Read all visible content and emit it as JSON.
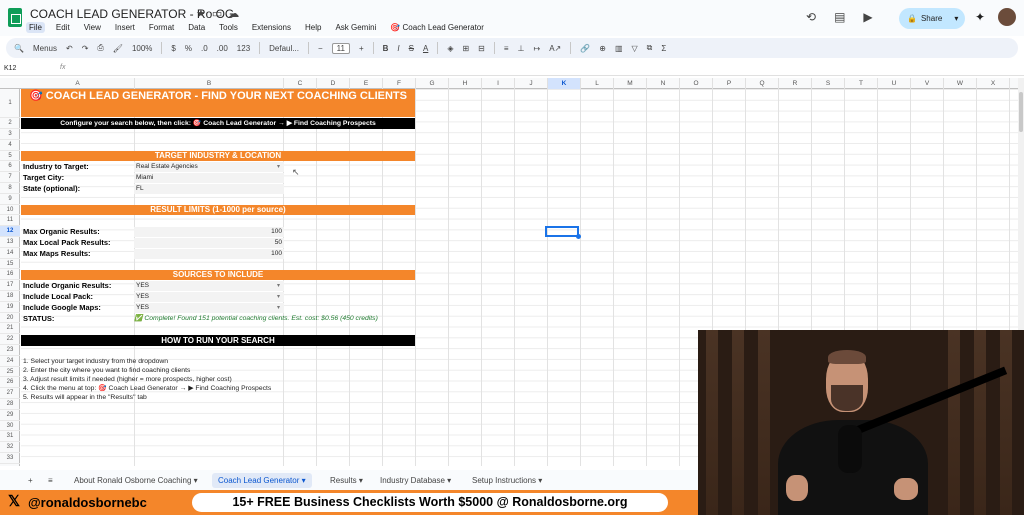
{
  "titlebar": {
    "doc_title": "COACH LEAD GENERATOR - Ro OG",
    "menu": [
      "File",
      "Edit",
      "View",
      "Insert",
      "Format",
      "Data",
      "Tools",
      "Extensions",
      "Help",
      "Ask Gemini"
    ],
    "custom_menu": "🎯 Coach Lead Generator",
    "share_label": "Share"
  },
  "toolbar": {
    "menus_label": "Menus",
    "zoom": "100%",
    "currency": "$",
    "percent": "%",
    "dec1": ".0",
    "dec2": ".00",
    "num_fmt": "123",
    "font": "Defaul...",
    "font_size": "11"
  },
  "formula": {
    "cell_ref": "K12",
    "fx": "fx"
  },
  "columns": [
    "A",
    "B",
    "C",
    "D",
    "E",
    "F",
    "G",
    "H",
    "I",
    "J",
    "K",
    "L",
    "M",
    "N",
    "O",
    "P",
    "Q",
    "R",
    "S",
    "T",
    "U",
    "V",
    "W",
    "X"
  ],
  "rows": [
    "1",
    "2",
    "3",
    "4",
    "5",
    "6",
    "7",
    "8",
    "9",
    "10",
    "11",
    "12",
    "13",
    "14",
    "15",
    "16",
    "17",
    "18",
    "19",
    "20",
    "21",
    "22",
    "23",
    "24",
    "25",
    "26",
    "27",
    "28",
    "29",
    "30",
    "31",
    "32",
    "33",
    "34",
    "35"
  ],
  "sheet": {
    "header_title": "🎯 COACH LEAD GENERATOR - FIND YOUR NEXT COACHING CLIENTS",
    "instructions_bar": "Configure your search below, then click: 🎯 Coach Lead Generator → ▶ Find Coaching Prospects",
    "section_target": "TARGET INDUSTRY & LOCATION",
    "industry_label": "Industry to Target:",
    "industry_value": "Real Estate Agencies",
    "city_label": "Target City:",
    "city_value": "Miami",
    "state_label": "State (optional):",
    "state_value": "FL",
    "section_limits": "RESULT LIMITS (1-1000 per source)",
    "organic_label": "Max Organic Results:",
    "organic_value": "100",
    "local_label": "Max Local Pack Results:",
    "local_value": "50",
    "maps_label": "Max Maps Results:",
    "maps_value": "100",
    "section_sources": "SOURCES TO INCLUDE",
    "inc_organic_label": "Include Organic Results:",
    "inc_organic_value": "YES",
    "inc_local_label": "Include Local Pack:",
    "inc_local_value": "YES",
    "inc_maps_label": "Include Google Maps:",
    "inc_maps_value": "YES",
    "status_label": "STATUS:",
    "status_value": "✅ Complete! Found 151 potential coaching clients. Est. cost: $0.56 (450 credits)",
    "section_howto": "HOW TO RUN YOUR SEARCH",
    "steps": [
      "1. Select your target industry from the dropdown",
      "2. Enter the city where you want to find coaching clients",
      "3. Adjust result limits if needed (higher = more prospects, higher cost)",
      "4. Click the menu at top: 🎯 Coach Lead Generator → ▶ Find Coaching Prospects",
      "5. Results will appear in the \"Results\" tab"
    ]
  },
  "tabs": [
    "About Ronald Osborne Coaching",
    "Coach Lead Generator",
    "Results",
    "Industry Database",
    "Setup Instructions"
  ],
  "banner": {
    "handle": "@ronaldosbornebc",
    "promo": "15+ FREE Business Checklists Worth $5000 @ Ronaldosborne.org"
  },
  "colors": {
    "accent_orange": "#f4862a",
    "header_black": "#000000",
    "share_blue": "#c2e7ff",
    "selection": "#1a73e8"
  }
}
